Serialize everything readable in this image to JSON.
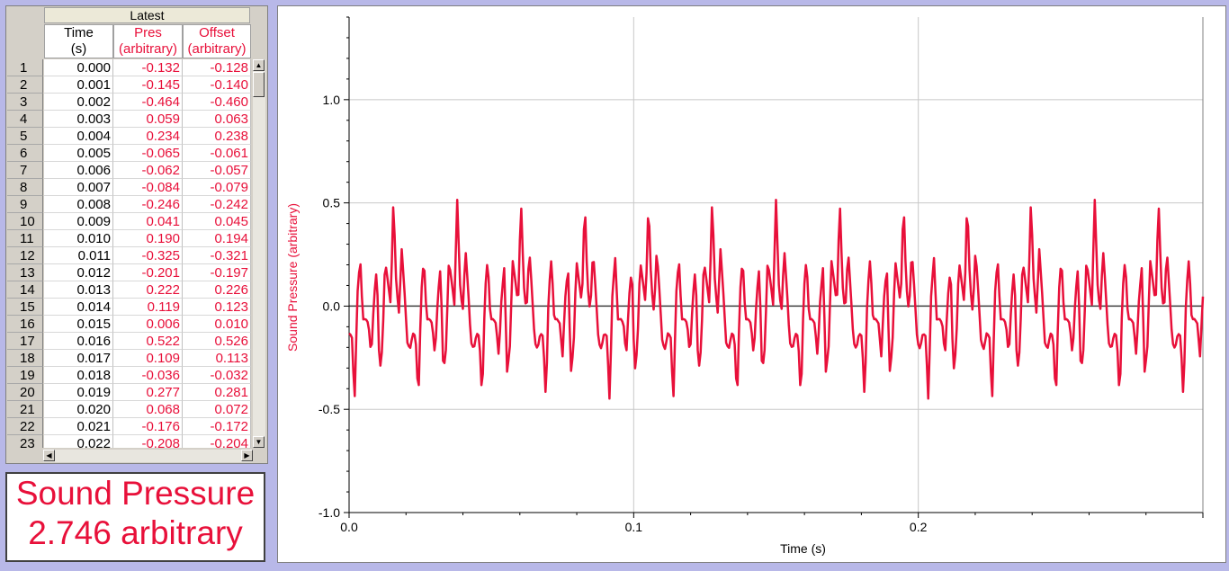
{
  "table": {
    "group_header": "Latest",
    "columns": [
      {
        "name": "Time",
        "unit": "(s)",
        "color": "#000000"
      },
      {
        "name": "Pres",
        "unit": "(arbitrary)",
        "color": "#e8103a"
      },
      {
        "name": "Offset",
        "unit": "(arbitrary)",
        "color": "#e8103a"
      }
    ],
    "rows": [
      {
        "i": "1",
        "t": "0.000",
        "p": "-0.132",
        "o": "-0.128"
      },
      {
        "i": "2",
        "t": "0.001",
        "p": "-0.145",
        "o": "-0.140"
      },
      {
        "i": "3",
        "t": "0.002",
        "p": "-0.464",
        "o": "-0.460"
      },
      {
        "i": "4",
        "t": "0.003",
        "p": "0.059",
        "o": "0.063"
      },
      {
        "i": "5",
        "t": "0.004",
        "p": "0.234",
        "o": "0.238"
      },
      {
        "i": "6",
        "t": "0.005",
        "p": "-0.065",
        "o": "-0.061"
      },
      {
        "i": "7",
        "t": "0.006",
        "p": "-0.062",
        "o": "-0.057"
      },
      {
        "i": "8",
        "t": "0.007",
        "p": "-0.084",
        "o": "-0.079"
      },
      {
        "i": "9",
        "t": "0.008",
        "p": "-0.246",
        "o": "-0.242"
      },
      {
        "i": "10",
        "t": "0.009",
        "p": "0.041",
        "o": "0.045"
      },
      {
        "i": "11",
        "t": "0.010",
        "p": "0.190",
        "o": "0.194"
      },
      {
        "i": "12",
        "t": "0.011",
        "p": "-0.325",
        "o": "-0.321"
      },
      {
        "i": "13",
        "t": "0.012",
        "p": "-0.201",
        "o": "-0.197"
      },
      {
        "i": "14",
        "t": "0.013",
        "p": "0.222",
        "o": "0.226"
      },
      {
        "i": "15",
        "t": "0.014",
        "p": "0.119",
        "o": "0.123"
      },
      {
        "i": "16",
        "t": "0.015",
        "p": "0.006",
        "o": "0.010"
      },
      {
        "i": "17",
        "t": "0.016",
        "p": "0.522",
        "o": "0.526"
      },
      {
        "i": "18",
        "t": "0.017",
        "p": "0.109",
        "o": "0.113"
      },
      {
        "i": "19",
        "t": "0.018",
        "p": "-0.036",
        "o": "-0.032"
      },
      {
        "i": "20",
        "t": "0.019",
        "p": "0.277",
        "o": "0.281"
      },
      {
        "i": "21",
        "t": "0.020",
        "p": "0.068",
        "o": "0.072"
      },
      {
        "i": "22",
        "t": "0.021",
        "p": "-0.176",
        "o": "-0.172"
      },
      {
        "i": "23",
        "t": "0.022",
        "p": "-0.208",
        "o": "-0.204"
      }
    ]
  },
  "meter": {
    "label": "Sound Pressure",
    "value": "2.746",
    "unit": "arbitrary",
    "color": "#e8103a"
  },
  "icons": {
    "scroll_up": "scroll-up-arrow-icon",
    "scroll_down": "scroll-down-arrow-icon",
    "scroll_left": "scroll-left-arrow-icon",
    "scroll_right": "scroll-right-arrow-icon"
  },
  "chart_data": {
    "type": "line",
    "xlabel": "Time (s)",
    "ylabel": "Sound Pressure (arbitrary)",
    "xlim": [
      0.0,
      0.3
    ],
    "ylim": [
      -1.0,
      1.4
    ],
    "x_ticks": [
      "0.0",
      "0.1",
      "0.2"
    ],
    "y_ticks": [
      "-1.0",
      "-0.5",
      "0.0",
      "0.5",
      "1.0"
    ],
    "grid": true,
    "line_color": "#e8103a",
    "sample_interval": 0.001,
    "period_s": 0.0224,
    "series": [
      {
        "values": [
          -0.132,
          -0.145,
          -0.464,
          0.059,
          0.234,
          -0.065,
          -0.062,
          -0.084,
          -0.246,
          0.041,
          0.19,
          -0.325,
          -0.201,
          0.222,
          0.119,
          0.006,
          0.522,
          0.109,
          -0.036,
          0.277,
          0.068,
          -0.176,
          -0.208
        ]
      }
    ]
  }
}
